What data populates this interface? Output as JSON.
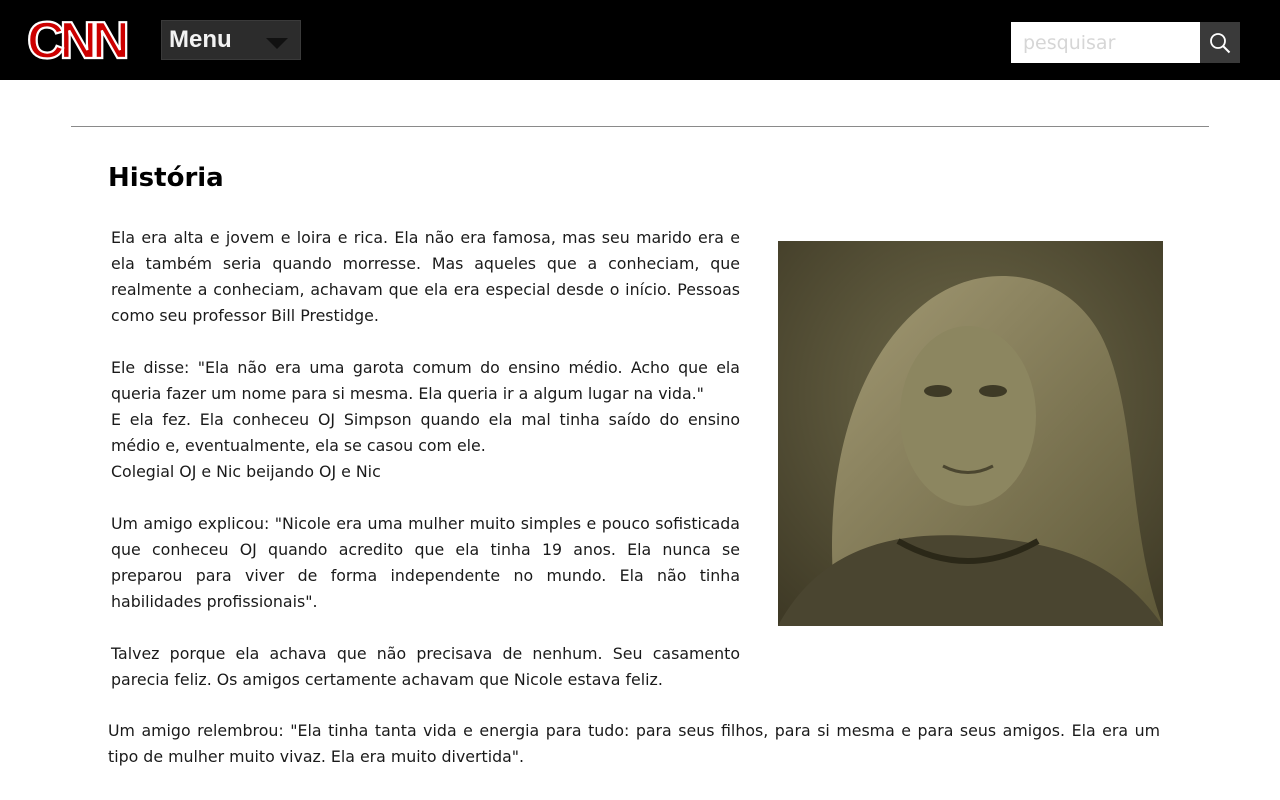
{
  "header": {
    "logo_text": "CNN",
    "menu_label": "Menu",
    "search_placeholder": "pesquisar",
    "colors": {
      "background": "#000000",
      "logo_red": "#cc0000",
      "menu_bg": "#2c2c2c"
    },
    "icons": {
      "menu_caret": "chevron-down-icon",
      "search": "search-icon"
    }
  },
  "article": {
    "title": "História",
    "paragraphs": [
      "Ela era alta e jovem e loira e rica. Ela não era famosa, mas seu marido era e ela também seria quando morresse. Mas aqueles que a conheciam, que realmente a conheciam, achavam que ela era especial desde o início. Pessoas como seu professor Bill Prestidge.",
      "Ele disse: \"Ela não era uma garota comum do ensino médio. Acho que ela queria fazer um nome para si mesma. Ela queria ir a algum lugar na vida.\"",
      "E ela fez. Ela conheceu OJ Simpson quando ela mal tinha saído do ensino médio e, eventualmente, ela se casou com ele.",
      "Colegial OJ e Nic beijando OJ e Nic",
      "Um amigo explicou: \"Nicole era uma mulher muito simples e pouco sofisticada que conheceu OJ quando acredito que ela tinha 19 anos. Ela nunca se preparou para viver de forma independente no mundo. Ela não tinha habilidades profissionais\".",
      "Talvez porque ela achava que não precisava de nenhum. Seu casamento parecia feliz. Os amigos certamente achavam que Nicole estava feliz.",
      "Um amigo relembrou: \"Ela tinha tanta vida e energia para tudo: para seus filhos, para si mesma e para seus amigos. Ela era um tipo de mulher muito vivaz. Ela era muito divertida\"."
    ]
  }
}
